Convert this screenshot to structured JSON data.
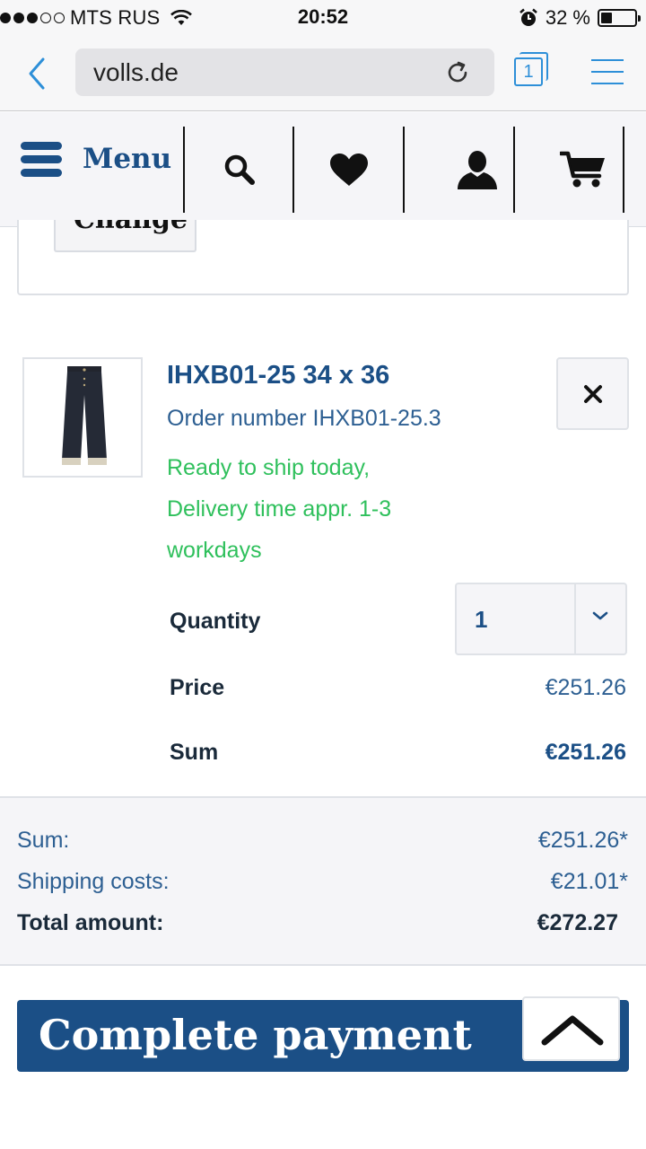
{
  "status_bar": {
    "carrier": "MTS RUS",
    "time": "20:52",
    "battery_percent": "32 %",
    "battery_level": 0.32
  },
  "browser": {
    "url": "volls.de",
    "tab_count": "1"
  },
  "site_nav": {
    "menu_label": "Menu"
  },
  "address": {
    "change_label": "Change"
  },
  "cart_item": {
    "name": "IHXB01-25 34 x 36",
    "order_number": "Order number IHXB01-25.3",
    "delivery_line1": "Ready to ship today,",
    "delivery_line2": "Delivery time appr. 1-3",
    "delivery_line3": "workdays",
    "quantity_label": "Quantity",
    "quantity_value": "1",
    "price_label": "Price",
    "price_value": "€251.26",
    "sum_label": "Sum",
    "sum_value": "€251.26"
  },
  "totals": {
    "sum_label": "Sum:",
    "sum_value": "€251.26*",
    "shipping_label": "Shipping costs:",
    "shipping_value": "€21.01*",
    "total_label": "Total amount:",
    "total_value": "€272.27"
  },
  "checkout": {
    "button_label": "Complete payment"
  },
  "colors": {
    "brand_blue": "#1b4f86",
    "link_blue": "#2d5f92",
    "ios_blue": "#2d8fd8",
    "success_green": "#2fc05c"
  },
  "icons": [
    "wifi-icon",
    "alarm-icon",
    "battery-icon",
    "back-icon",
    "reload-icon",
    "tabs-icon",
    "hamburger-icon",
    "menu-icon",
    "search-icon",
    "heart-icon",
    "user-icon",
    "cart-icon",
    "close-icon",
    "chevron-down-icon",
    "chevron-up-icon"
  ]
}
